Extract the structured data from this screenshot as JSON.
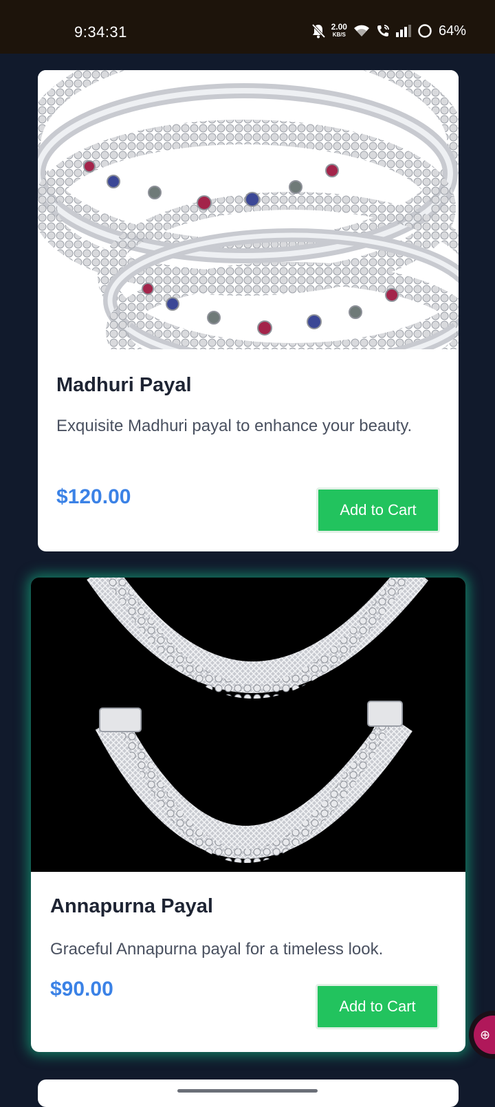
{
  "status_bar": {
    "time": "9:34:31",
    "net_speed_value": "2.00",
    "net_speed_unit": "KB/S",
    "battery": "64%",
    "icons": [
      "mute-bell-icon",
      "wifi-icon",
      "wifi-call-icon",
      "signal-icon",
      "battery-ring-icon"
    ]
  },
  "products": [
    {
      "name": "Madhuri Payal",
      "description": "Exquisite Madhuri payal to enhance your beauty.",
      "price": "$120.00",
      "button_label": "Add to Cart",
      "image": "silver-anklet-pair-with-colored-stones"
    },
    {
      "name": "Annapurna Payal",
      "description": "Graceful Annapurna payal for a timeless look.",
      "price": "$90.00",
      "button_label": "Add to Cart",
      "image": "silver-anklet-pair-on-black"
    }
  ],
  "colors": {
    "background": "#111a2c",
    "price": "#3b82e6",
    "button": "#22c35e",
    "highlight_glow": "#14c88c",
    "fab": "#b0185a"
  }
}
